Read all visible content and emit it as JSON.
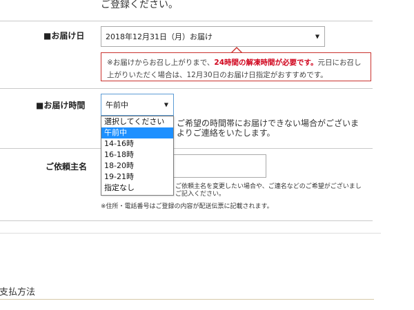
{
  "intro": {
    "text": "ご登録ください。"
  },
  "delivery_date": {
    "label": "■お届け日",
    "selected": "2018年12月31日（月）お届け",
    "notice_prefix": "※お届けからお召し上がりまで、",
    "notice_highlight": "24時間の解凍時間が必要です。",
    "notice_suffix": "元日にお召し上がりいただく場合は、12月30日のお届け日指定がおすすめです。"
  },
  "delivery_time": {
    "label": "■お届け時間",
    "selected": "午前中",
    "options": [
      "選択してください",
      "午前中",
      "14-16時",
      "16-18時",
      "18-20時",
      "19-21時",
      "指定なし"
    ],
    "selected_index": 1,
    "note_line1": "ご希望の時間帯にお届けできない場合がございま",
    "note_line2": "よりご連絡をいたします。"
  },
  "requester": {
    "label": "ご依頼主名",
    "note_line1": "ご依頼主名を変更したい場合や、ご連名などのご希望がございまし",
    "note_line2": "ご記入ください。",
    "address_note": "※住所・電話番号はご登録の内容が配送伝票に記載されます。"
  },
  "payment": {
    "title": "支払方法"
  },
  "colors": {
    "notice_border": "#c9302c",
    "highlight_red": "#d0021b",
    "option_highlight": "#1e90ff"
  }
}
